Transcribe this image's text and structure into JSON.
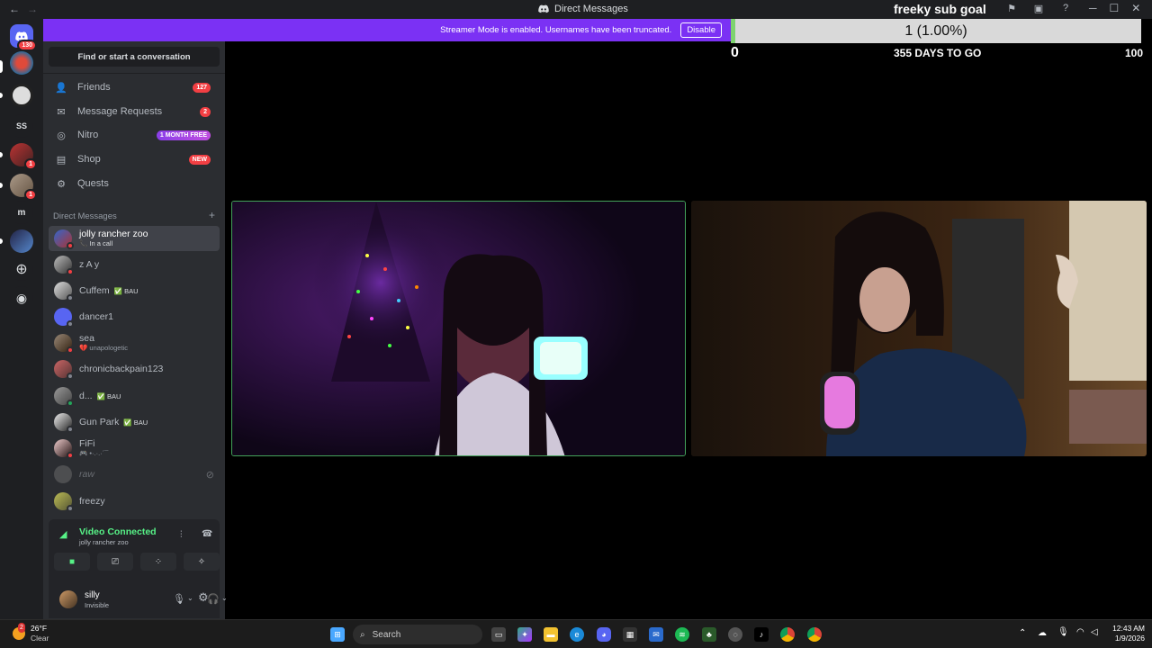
{
  "window": {
    "title": "Direct Messages",
    "back": "←",
    "forward": "→",
    "minimize": "─",
    "maximize": "☐",
    "close": "✕"
  },
  "banner": {
    "text": "Streamer Mode is enabled. Usernames have been truncated.",
    "button": "Disable"
  },
  "sub_goal": {
    "title": "freeky sub goal",
    "progress_text": "1 (1.00%)",
    "progress_fraction": 0.01,
    "min": "0",
    "days_left": "355 DAYS TO GO",
    "max": "100"
  },
  "servers": [
    {
      "icon": "discord-home-icon",
      "badge": "130"
    },
    {
      "icon": "server-avatar-icon"
    },
    {
      "icon": "server-avatar-icon"
    },
    {
      "label": "SS"
    },
    {
      "icon": "server-avatar-icon",
      "badge": "1"
    },
    {
      "icon": "server-avatar-icon",
      "badge": "1"
    },
    {
      "label": "m"
    },
    {
      "icon": "server-avatar-icon"
    },
    {
      "icon": "add-server-icon"
    },
    {
      "icon": "explore-icon"
    }
  ],
  "sidebar": {
    "find": "Find or start a conversation",
    "nav": [
      {
        "label": "Friends",
        "badge": "127",
        "icon": "friends-icon"
      },
      {
        "label": "Message Requests",
        "badge": "2",
        "icon": "mail-icon"
      },
      {
        "label": "Nitro",
        "badge": "1 MONTH FREE",
        "icon": "nitro-icon"
      },
      {
        "label": "Shop",
        "badge": "NEW",
        "icon": "shop-icon"
      },
      {
        "label": "Quests",
        "icon": "quests-icon"
      }
    ],
    "dm_header": "Direct Messages",
    "dm_add": "+",
    "dms": [
      {
        "name": "jolly rancher zoo",
        "sub": "📞 In a call"
      },
      {
        "name": "z A y"
      },
      {
        "name": "Cuffem",
        "tag": "✅ BAU"
      },
      {
        "name": "dancer1"
      },
      {
        "name": "sea",
        "sub": "💔 unapologetic"
      },
      {
        "name": "chronicbackpain123"
      },
      {
        "name": "d...",
        "tag": "✅ BAU"
      },
      {
        "name": "Gun Park",
        "tag": "✅ BAU"
      },
      {
        "name": "FiFi",
        "sub": "🎮 •·.·.·´¯"
      },
      {
        "name": "raw"
      },
      {
        "name": "freezy"
      }
    ]
  },
  "voice": {
    "status": "Video Connected",
    "channel": "jolly rancher zoo"
  },
  "user": {
    "name": "silly",
    "status": "Invisible"
  },
  "taskbar": {
    "temp": "26°F",
    "weather": "Clear",
    "weather_badge": "2",
    "search": "Search",
    "time": "12:43 AM",
    "date": "1/9/2026"
  }
}
